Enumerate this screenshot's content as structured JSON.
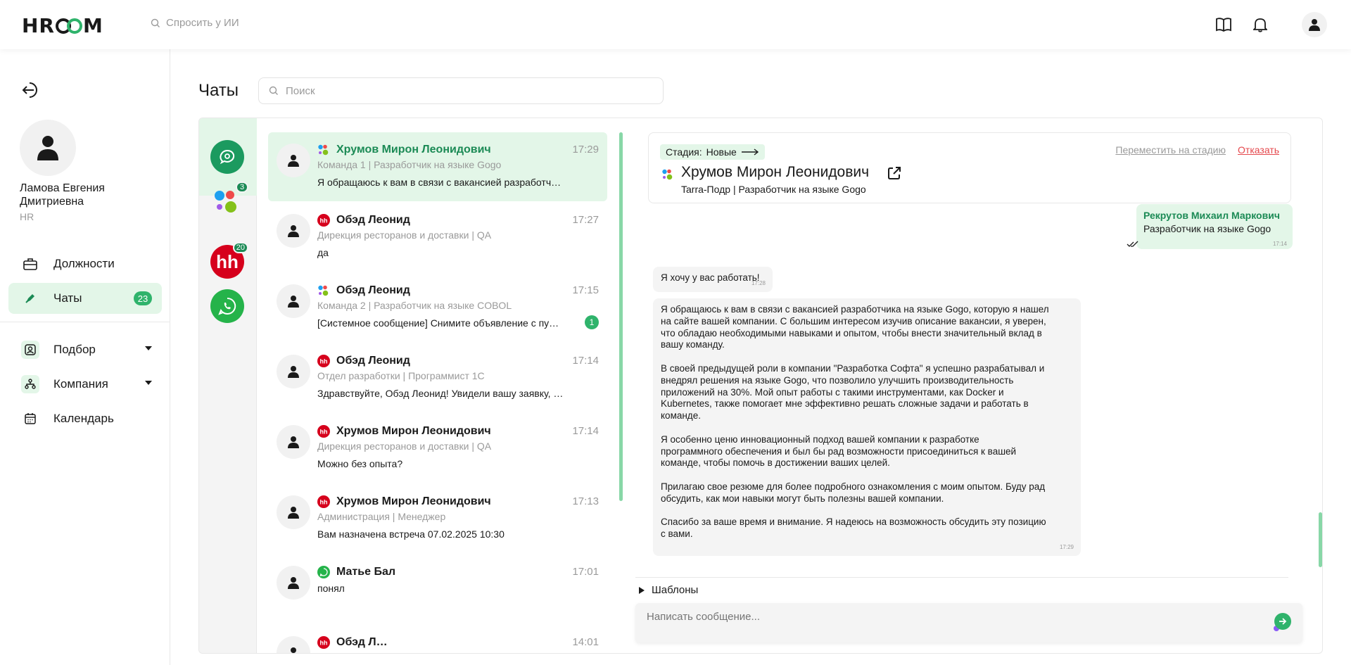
{
  "header": {
    "logo": "HR",
    "logo_end": "M",
    "ask_ai_placeholder": "Спросить у ИИ",
    "icons": [
      "book-icon",
      "bell-icon",
      "user-icon"
    ]
  },
  "sidebar": {
    "profile_name": "Ламова Евгения Дмитриевна",
    "profile_role": "HR",
    "items": [
      {
        "label": "Должности",
        "icon": "briefcase-icon"
      },
      {
        "label": "Чаты",
        "icon": "chat-icon",
        "badge": "23",
        "active": true
      },
      {
        "label": "Подбор",
        "icon": "recruit-icon"
      },
      {
        "label": "Компания",
        "icon": "company-icon"
      },
      {
        "label": "Календарь",
        "icon": "calendar-icon"
      }
    ]
  },
  "page": {
    "title": "Чаты",
    "search_placeholder": "Поиск"
  },
  "channels": [
    {
      "name": "all-chats",
      "badge": ""
    },
    {
      "name": "multi-source",
      "badge": "3"
    },
    {
      "name": "hh",
      "badge": "20",
      "label": "hh"
    },
    {
      "name": "whatsapp",
      "badge": ""
    }
  ],
  "chats": [
    {
      "name": "Хрумов Мирон Леонидович",
      "time": "17:29",
      "sub": "Команда 1 | Разработчик на языке Gogo",
      "msg": "Я обращаюсь к вам в связи с вакансией разработч…",
      "source": "multi",
      "unread": "",
      "selected": true
    },
    {
      "name": "Обэд Леонид",
      "time": "17:27",
      "sub": "Дирекция ресторанов и доставки | QA",
      "msg": "да",
      "source": "hh",
      "unread": ""
    },
    {
      "name": "Обэд Леонид",
      "time": "17:15",
      "sub": "Команда 2 | Разработчик на языке COBOL",
      "msg": "[Системное сообщение] Снимите объявление с пу…",
      "source": "multi",
      "unread": "1"
    },
    {
      "name": "Обэд Леонид",
      "time": "17:14",
      "sub": "Отдел разработки | Программист 1С",
      "msg": "Здравствуйте, Обэд Леонид! Увидели вашу заявку, …",
      "source": "hh",
      "unread": ""
    },
    {
      "name": "Хрумов Мирон Леонидович",
      "time": "17:14",
      "sub": "Дирекция ресторанов и доставки | QA",
      "msg": "Можно без опыта?",
      "source": "hh",
      "unread": ""
    },
    {
      "name": "Хрумов Мирон Леонидович",
      "time": "17:13",
      "sub": "Администрация | Менеджер",
      "msg": "Вам назначена встреча 07.02.2025 10:30",
      "source": "hh",
      "unread": ""
    },
    {
      "name": "Матье Бал",
      "time": "17:01",
      "sub": "",
      "msg": "понял",
      "source": "whatsapp",
      "unread": ""
    },
    {
      "name": "Обэд Л…",
      "time": "14:01",
      "sub": "",
      "msg": "",
      "source": "hh",
      "unread": ""
    }
  ],
  "conversation": {
    "stage_label": "Стадия:",
    "stage_value": "Новые",
    "candidate_name": "Хрумов Мирон Леонидович",
    "candidate_sub": "Tarra-Подр | Разработчик на языке Gogo",
    "move_link": "Переместить на стадию",
    "reject_link": "Отказать",
    "outgoing": {
      "name": "Рекрутов Михаил Маркович",
      "text": "Разработчик на языке Gogo",
      "time": "17:14"
    },
    "incoming_short": {
      "text": "Я хочу у вас работать!",
      "time": "17:28"
    },
    "incoming_long": {
      "paragraphs": [
        "Я обращаюсь к вам в связи с вакансией разработчика на языке Gogo, которую я нашел\nна сайте вашей компании. С большим интересом изучив описание вакансии, я уверен,\nчто обладаю необходимыми навыками и опытом, чтобы внести значительный вклад в\nвашу команду.",
        "В своей предыдущей роли в компании \"Разработка Софта\" я успешно разрабатывал и\nвнедрял решения на языке Gogo, что позволило улучшить производительность\nприложений на 30%. Мой опыт работы с такими инструментами, как Docker и\nKubernetes, также помогает мне эффективно решать сложные задачи и работать в\nкоманде.",
        "Я особенно ценю инновационный подход вашей компании к разработке\nпрограммного обеспечения и был бы рад возможности присоединиться к вашей\nкоманде, чтобы помочь в достижении ваших целей.",
        "Прилагаю свое резюме для более подробного ознакомления с моим опытом. Буду рад\nобсудить, как мои навыки могут быть полезны вашей компании.",
        "Спасибо за ваше время и внимание. Я надеюсь на возможность обсудить эту позицию\nс вами."
      ],
      "time": "17:29"
    },
    "templates_label": "Шаблоны",
    "composer_placeholder": "Написать сообщение..."
  },
  "colors": {
    "accent": "#2fb36b",
    "accent_light": "#e3f6e8",
    "danger": "#e5484d",
    "hh": "#d6001c",
    "whatsapp": "#25b34a"
  }
}
